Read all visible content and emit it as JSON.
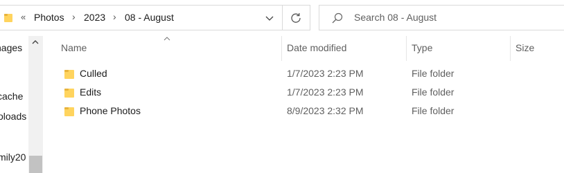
{
  "address_bar": {
    "overflow_glyph": "«",
    "breadcrumbs": [
      "Photos",
      "2023",
      "08 - August"
    ],
    "separator_glyph": "›"
  },
  "search": {
    "placeholder": "Search 08 - August",
    "icon": "search-icon"
  },
  "nav_pane": {
    "items": [
      "nages",
      "cache",
      "oloads",
      "mily20"
    ]
  },
  "columns": {
    "name": "Name",
    "date_modified": "Date modified",
    "type": "Type",
    "size": "Size"
  },
  "files": [
    {
      "name": "Culled",
      "date_modified": "1/7/2023 2:23 PM",
      "type": "File folder",
      "icon": "folder-icon"
    },
    {
      "name": "Edits",
      "date_modified": "1/7/2023 2:23 PM",
      "type": "File folder",
      "icon": "folder-icon"
    },
    {
      "name": "Phone Photos",
      "date_modified": "8/9/2023 2:32 PM",
      "type": "File folder",
      "icon": "folder-icon"
    }
  ],
  "colors": {
    "folder_yellow": "#FFD45E",
    "folder_dark": "#E8B33C",
    "border": "#D9D9D9",
    "secondary_text": "#5F5F5F"
  }
}
